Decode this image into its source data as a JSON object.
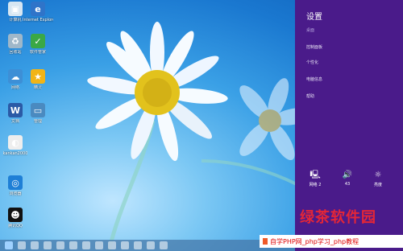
{
  "desktop": {
    "icons": [
      {
        "name": "computer-icon",
        "label": "计算机",
        "glyph": "▣",
        "color": "#d6e6f2"
      },
      {
        "name": "ie-icon",
        "label": "Internet Explorer",
        "glyph": "e",
        "color": "#2f74c9"
      },
      {
        "name": "recycle-bin-icon",
        "label": "回收站",
        "glyph": "♻",
        "color": "#9fb7c9"
      },
      {
        "name": "app-icon",
        "label": "软件管家",
        "glyph": "✓",
        "color": "#3aa846"
      },
      {
        "name": "network-icon",
        "label": "网络",
        "glyph": "☁",
        "color": "#3d8fd6"
      },
      {
        "name": "star-app-icon",
        "label": "精灵",
        "glyph": "★",
        "color": "#f1b417"
      },
      {
        "name": "word-icon",
        "label": "文档",
        "glyph": "W",
        "color": "#2b5aa6"
      },
      {
        "name": "disk-icon",
        "label": "管理",
        "glyph": "▭",
        "color": "#4a8ac0"
      },
      {
        "name": "player-icon",
        "label": "kankan2000",
        "glyph": "◐",
        "color": "#eeeeee"
      },
      {
        "name": "browser-icon",
        "label": "浏览器",
        "glyph": "◎",
        "color": "#1e7fd6"
      },
      {
        "name": "qq-icon",
        "label": "腾讯QQ",
        "glyph": "☻",
        "color": "#111111"
      }
    ]
  },
  "charms": {
    "title": "设置",
    "links": [
      "桌面",
      "控制面板",
      "个性化",
      "电脑信息",
      "帮助"
    ],
    "tiles": [
      {
        "name": "network-tile",
        "icon": "network-icon",
        "glyph": "🖳",
        "caption": "网络 2"
      },
      {
        "name": "volume-tile",
        "icon": "volume-icon",
        "glyph": "🔊",
        "caption": "43"
      },
      {
        "name": "brightness-tile",
        "icon": "brightness-icon",
        "glyph": "☼",
        "caption": "亮度"
      }
    ]
  },
  "taskbar": {
    "button_count": 13
  },
  "watermark": {
    "text": "绿茶软件园"
  },
  "caption": {
    "text": "自学PHP网_php学习_php教程"
  }
}
